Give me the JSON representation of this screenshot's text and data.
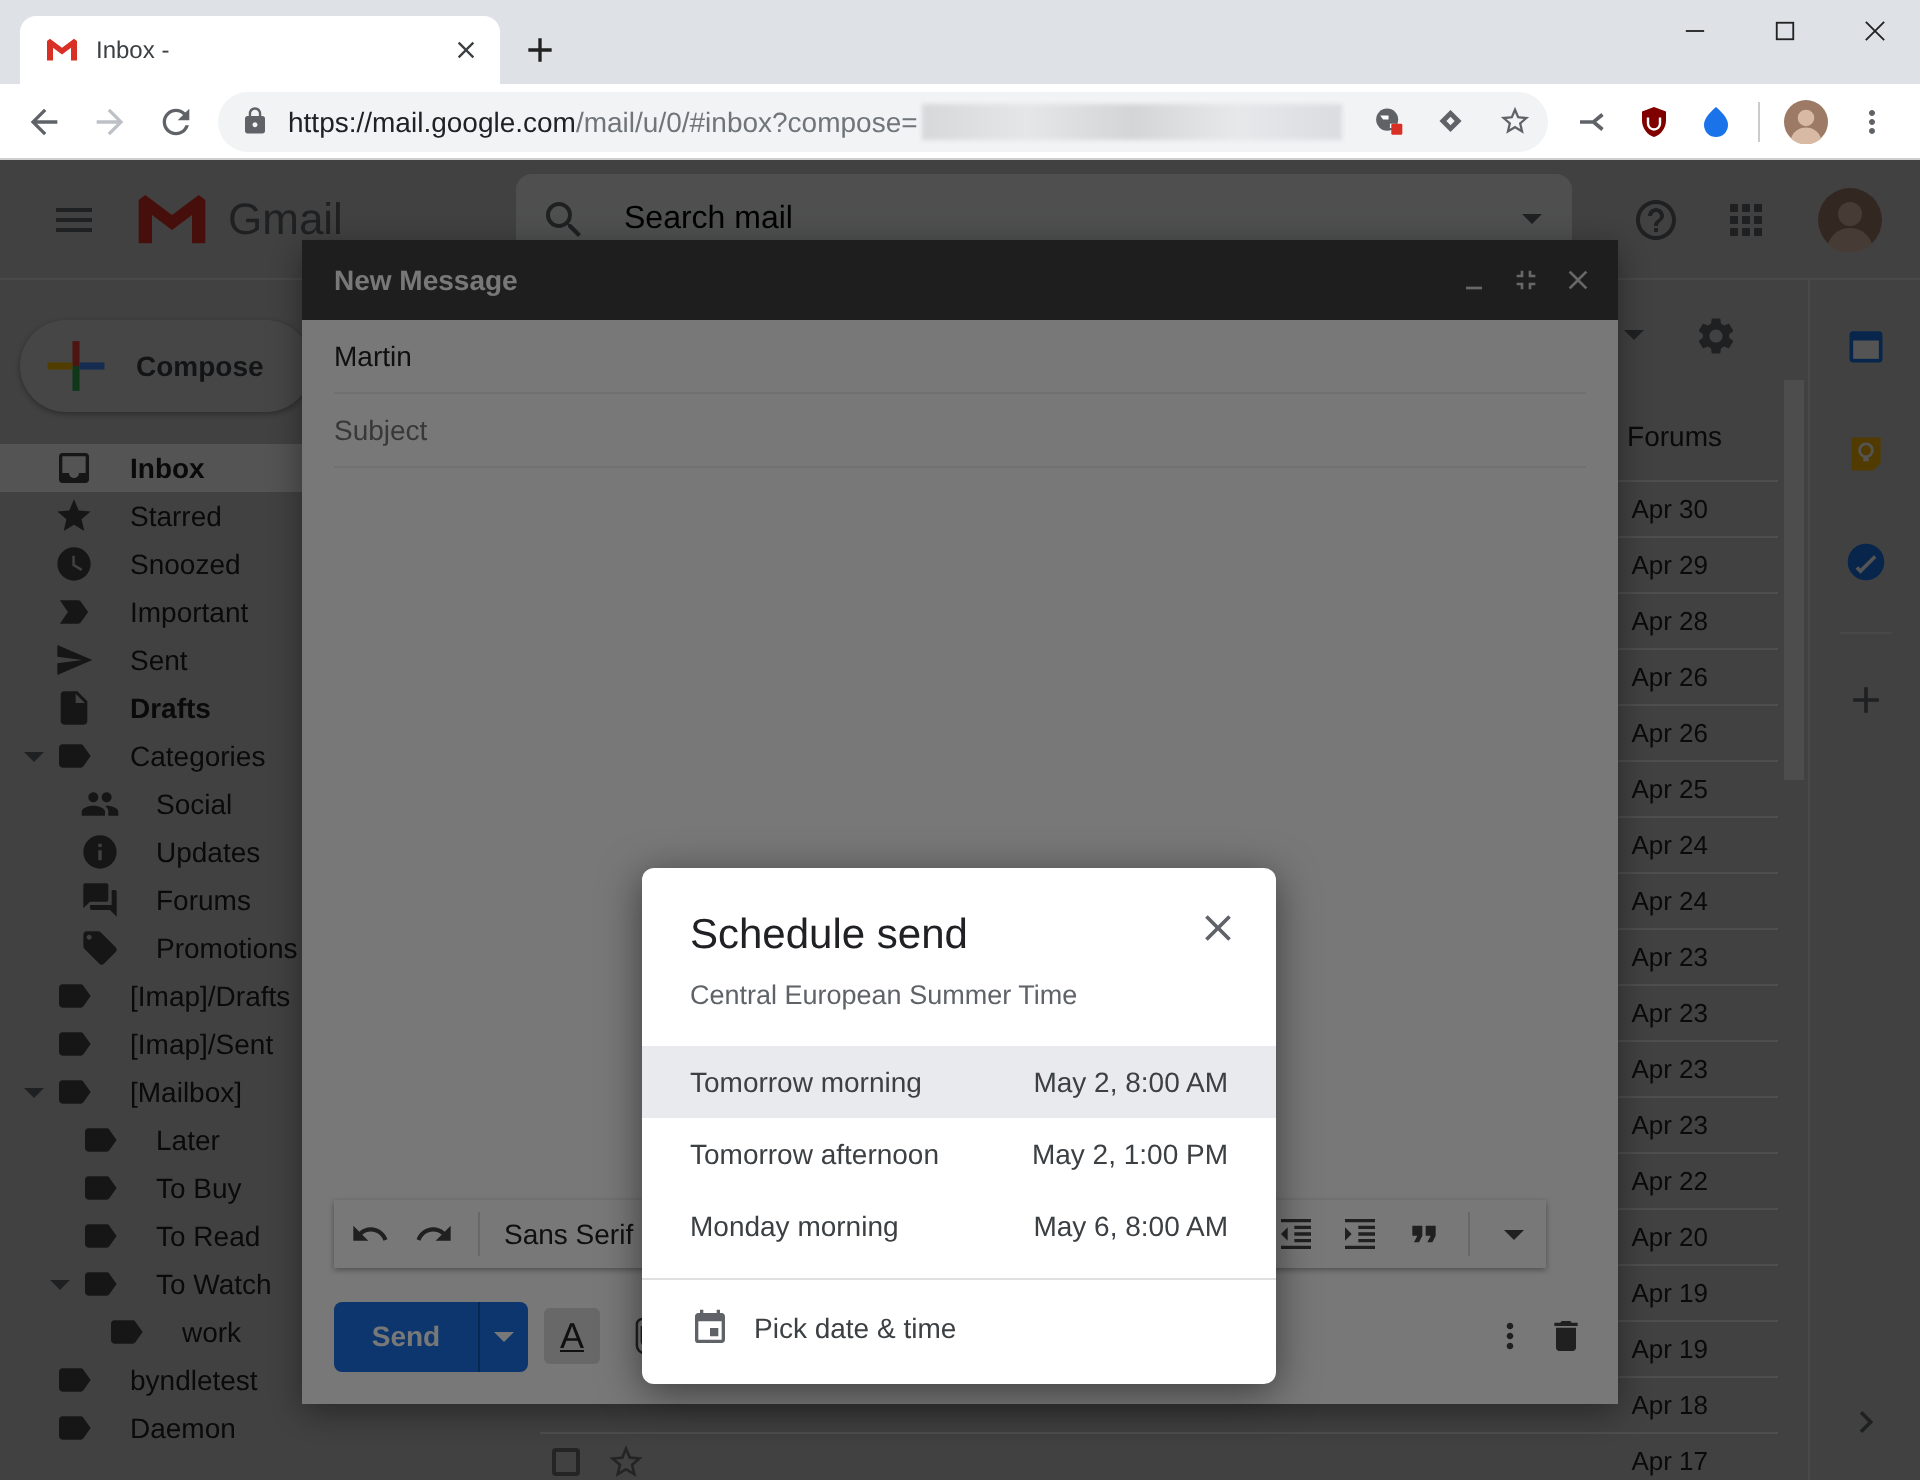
{
  "browser": {
    "tab": {
      "title": "Inbox -"
    },
    "url": {
      "host": "https://mail.google.com",
      "path": "/mail/u/0/#inbox?compose=",
      "redacted": true
    },
    "forward_disabled": true
  },
  "gmail": {
    "app_name": "Gmail",
    "search": {
      "placeholder": "Search mail"
    },
    "compose_button": "Compose",
    "sidebar": [
      {
        "label": "Inbox",
        "kind": "inbox",
        "unread": true,
        "selected": true
      },
      {
        "label": "Starred",
        "kind": "starred",
        "unread": false,
        "selected": false
      },
      {
        "label": "Snoozed",
        "kind": "snoozed",
        "unread": false,
        "selected": false
      },
      {
        "label": "Important",
        "kind": "important",
        "unread": false,
        "selected": false
      },
      {
        "label": "Sent",
        "kind": "sent",
        "unread": false,
        "selected": false
      },
      {
        "label": "Drafts",
        "kind": "drafts",
        "unread": true,
        "selected": false
      },
      {
        "label": "Categories",
        "kind": "label",
        "unread": false,
        "selected": false,
        "expanded": true,
        "children": [
          {
            "label": "Social",
            "kind": "social",
            "unread": false,
            "selected": false
          },
          {
            "label": "Updates",
            "kind": "updates",
            "unread": false,
            "selected": false
          },
          {
            "label": "Forums",
            "kind": "forums",
            "unread": false,
            "selected": false
          },
          {
            "label": "Promotions",
            "kind": "promotions",
            "unread": false,
            "selected": false
          }
        ]
      },
      {
        "label": "[Imap]/Drafts",
        "kind": "label",
        "unread": false,
        "selected": false
      },
      {
        "label": "[Imap]/Sent",
        "kind": "label",
        "unread": false,
        "selected": false
      },
      {
        "label": "[Mailbox]",
        "kind": "label",
        "unread": false,
        "selected": false,
        "expanded": true,
        "children": [
          {
            "label": "Later",
            "kind": "label",
            "unread": false,
            "selected": false
          },
          {
            "label": "To Buy",
            "kind": "label",
            "unread": false,
            "selected": false
          },
          {
            "label": "To Read",
            "kind": "label",
            "unread": false,
            "selected": false
          },
          {
            "label": "To Watch",
            "kind": "label",
            "unread": false,
            "selected": false,
            "expanded": true,
            "children": [
              {
                "label": "work",
                "kind": "label",
                "unread": false,
                "selected": false
              }
            ]
          }
        ]
      },
      {
        "label": "byndletest",
        "kind": "label",
        "unread": false,
        "selected": false
      },
      {
        "label": "Daemon",
        "kind": "label",
        "unread": false,
        "selected": false
      }
    ],
    "category_tab": "Forums",
    "emails": [
      {
        "date": "Apr 30"
      },
      {
        "date": "Apr 29"
      },
      {
        "date": "Apr 28"
      },
      {
        "date": "Apr 26"
      },
      {
        "date": "Apr 26"
      },
      {
        "date": "Apr 25"
      },
      {
        "date": "Apr 24"
      },
      {
        "date": "Apr 24"
      },
      {
        "date": "Apr 23"
      },
      {
        "date": "Apr 23"
      },
      {
        "date": "Apr 23"
      },
      {
        "date": "Apr 23"
      },
      {
        "date": "Apr 22"
      },
      {
        "date": "Apr 20"
      },
      {
        "date": "Apr 19"
      },
      {
        "date": "Apr 19"
      },
      {
        "date": "Apr 18"
      },
      {
        "date": "Apr 17",
        "checked": false
      }
    ]
  },
  "compose": {
    "title": "New Message",
    "to": "Martin",
    "subject_placeholder": "Subject",
    "font": "Sans Serif",
    "send": "Send",
    "format_glyph": "A"
  },
  "schedule_dialog": {
    "title": "Schedule send",
    "timezone": "Central European Summer Time",
    "options": [
      {
        "label": "Tomorrow morning",
        "time": "May 2, 8:00 AM",
        "selected": true
      },
      {
        "label": "Tomorrow afternoon",
        "time": "May 2, 1:00 PM",
        "selected": false
      },
      {
        "label": "Monday morning",
        "time": "May 6, 8:00 AM",
        "selected": false
      }
    ],
    "pick": "Pick date & time"
  }
}
